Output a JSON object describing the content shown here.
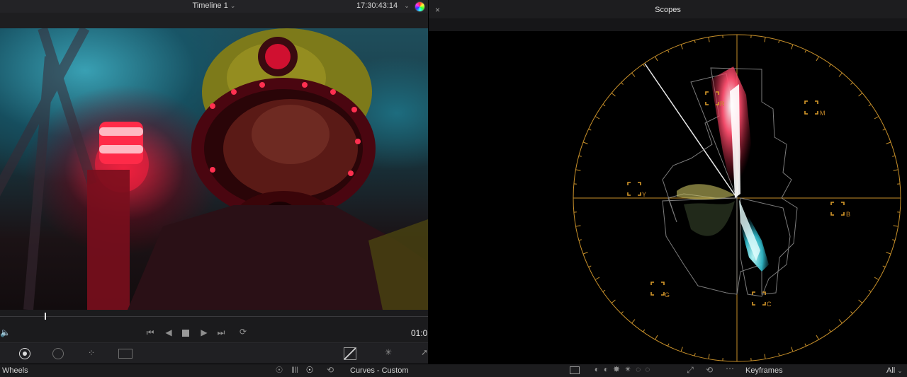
{
  "viewer": {
    "timeline_name": "Timeline 1",
    "timecode": "17:30:43:14",
    "end_time": "01:0"
  },
  "scopes": {
    "title": "Scopes",
    "close_symbol": "×",
    "targets": [
      "R",
      "M",
      "Y",
      "B",
      "G",
      "C"
    ],
    "graticule_color": "#c8902a"
  },
  "bottom": {
    "wheels_label": "Wheels",
    "curves_label": "Curves - Custom",
    "keyframes_label": "Keyframes",
    "keyframes_filter": "All"
  },
  "icons": {
    "timeline_menu": "chevron-down-icon",
    "timecode_menu": "chevron-down-icon",
    "color_picker": "color-wheel-icon",
    "speaker": "speaker-icon",
    "first_frame": "skip-back-icon",
    "play_reverse": "play-reverse-icon",
    "stop": "stop-icon",
    "play": "play-icon",
    "last_frame": "skip-forward-icon",
    "loop": "loop-icon"
  }
}
